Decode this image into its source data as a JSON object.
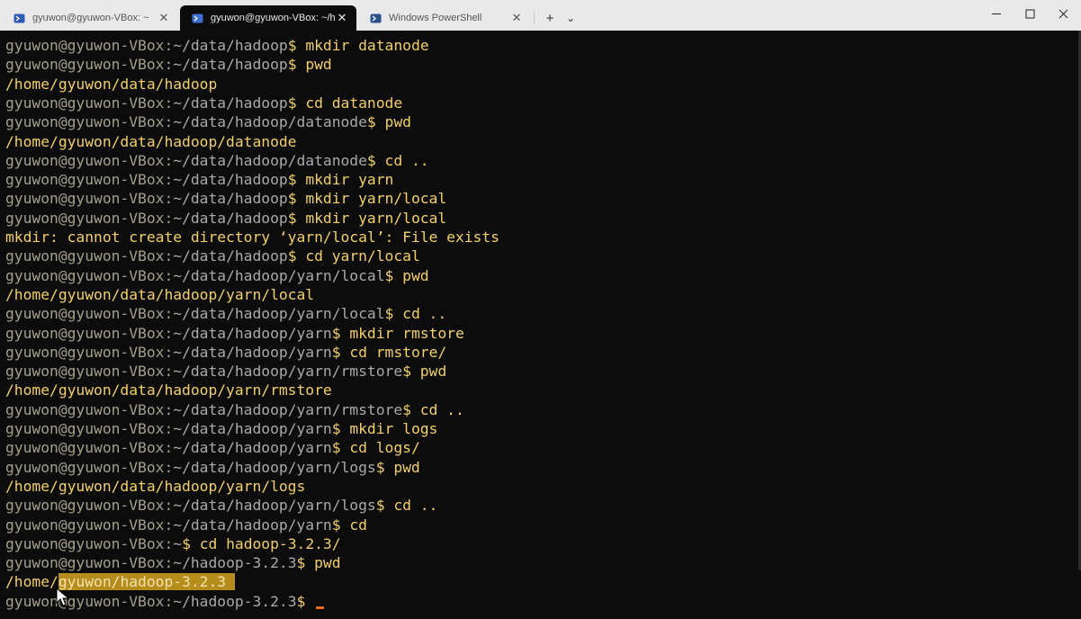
{
  "tabs": [
    {
      "title": "gyuwon@gyuwon-VBox: ~",
      "active": false,
      "icon": "terminal-icon"
    },
    {
      "title": "gyuwon@gyuwon-VBox: ~/h",
      "active": true,
      "icon": "terminal-icon"
    },
    {
      "title": "Windows PowerShell",
      "active": false,
      "icon": "powershell-icon"
    }
  ],
  "toolbar": {
    "new_tab": "+",
    "dropdown": "⌄"
  },
  "window_controls": {
    "minimize": "—",
    "maximize": "☐",
    "close": "✕"
  },
  "terminal": {
    "lines": [
      {
        "host": "gyuwon@gyuwon-VBox",
        "path": "~/data/hadoop",
        "cmd": "mkdir datanode"
      },
      {
        "host": "gyuwon@gyuwon-VBox",
        "path": "~/data/hadoop",
        "cmd": "pwd"
      },
      {
        "out": "/home/gyuwon/data/hadoop"
      },
      {
        "host": "gyuwon@gyuwon-VBox",
        "path": "~/data/hadoop",
        "cmd": "cd datanode"
      },
      {
        "host": "gyuwon@gyuwon-VBox",
        "path": "~/data/hadoop/datanode",
        "cmd": "pwd"
      },
      {
        "out": "/home/gyuwon/data/hadoop/datanode"
      },
      {
        "host": "gyuwon@gyuwon-VBox",
        "path": "~/data/hadoop/datanode",
        "cmd": "cd .."
      },
      {
        "host": "gyuwon@gyuwon-VBox",
        "path": "~/data/hadoop",
        "cmd": "mkdir yarn"
      },
      {
        "host": "gyuwon@gyuwon-VBox",
        "path": "~/data/hadoop",
        "cmd": "mkdir yarn/local"
      },
      {
        "host": "gyuwon@gyuwon-VBox",
        "path": "~/data/hadoop",
        "cmd": "mkdir yarn/local"
      },
      {
        "out": "mkdir: cannot create directory ‘yarn/local’: File exists"
      },
      {
        "host": "gyuwon@gyuwon-VBox",
        "path": "~/data/hadoop",
        "cmd": "cd yarn/local"
      },
      {
        "host": "gyuwon@gyuwon-VBox",
        "path": "~/data/hadoop/yarn/local",
        "cmd": "pwd"
      },
      {
        "out": "/home/gyuwon/data/hadoop/yarn/local"
      },
      {
        "host": "gyuwon@gyuwon-VBox",
        "path": "~/data/hadoop/yarn/local",
        "cmd": "cd .."
      },
      {
        "host": "gyuwon@gyuwon-VBox",
        "path": "~/data/hadoop/yarn",
        "cmd": "mkdir rmstore"
      },
      {
        "host": "gyuwon@gyuwon-VBox",
        "path": "~/data/hadoop/yarn",
        "cmd": "cd rmstore/"
      },
      {
        "host": "gyuwon@gyuwon-VBox",
        "path": "~/data/hadoop/yarn/rmstore",
        "cmd": "pwd"
      },
      {
        "out": "/home/gyuwon/data/hadoop/yarn/rmstore"
      },
      {
        "host": "gyuwon@gyuwon-VBox",
        "path": "~/data/hadoop/yarn/rmstore",
        "cmd": "cd .."
      },
      {
        "host": "gyuwon@gyuwon-VBox",
        "path": "~/data/hadoop/yarn",
        "cmd": "mkdir logs"
      },
      {
        "host": "gyuwon@gyuwon-VBox",
        "path": "~/data/hadoop/yarn",
        "cmd": "cd logs/"
      },
      {
        "host": "gyuwon@gyuwon-VBox",
        "path": "~/data/hadoop/yarn/logs",
        "cmd": "pwd"
      },
      {
        "out": "/home/gyuwon/data/hadoop/yarn/logs"
      },
      {
        "host": "gyuwon@gyuwon-VBox",
        "path": "~/data/hadoop/yarn/logs",
        "cmd": "cd .."
      },
      {
        "host": "gyuwon@gyuwon-VBox",
        "path": "~/data/hadoop/yarn",
        "cmd": "cd"
      },
      {
        "host": "gyuwon@gyuwon-VBox",
        "path": "~",
        "cmd": "cd hadoop-3.2.3/"
      },
      {
        "host": "gyuwon@gyuwon-VBox",
        "path": "~/hadoop-3.2.3",
        "cmd": "pwd"
      },
      {
        "out": "/home/",
        "selected": "gyuwon/hadoop-3.2.3 "
      },
      {
        "host": "gyuwon@gyuwon-VBox",
        "path": "~/hadoop-3.2.3",
        "cmd": "",
        "cursor": true
      }
    ]
  },
  "colors": {
    "host": "#a3a08c",
    "path": "#a9a9ae",
    "command": "#f3cf6c",
    "selection": "#b58d1d",
    "cursor": "#e86a1b",
    "background": "#0c0c0c"
  }
}
